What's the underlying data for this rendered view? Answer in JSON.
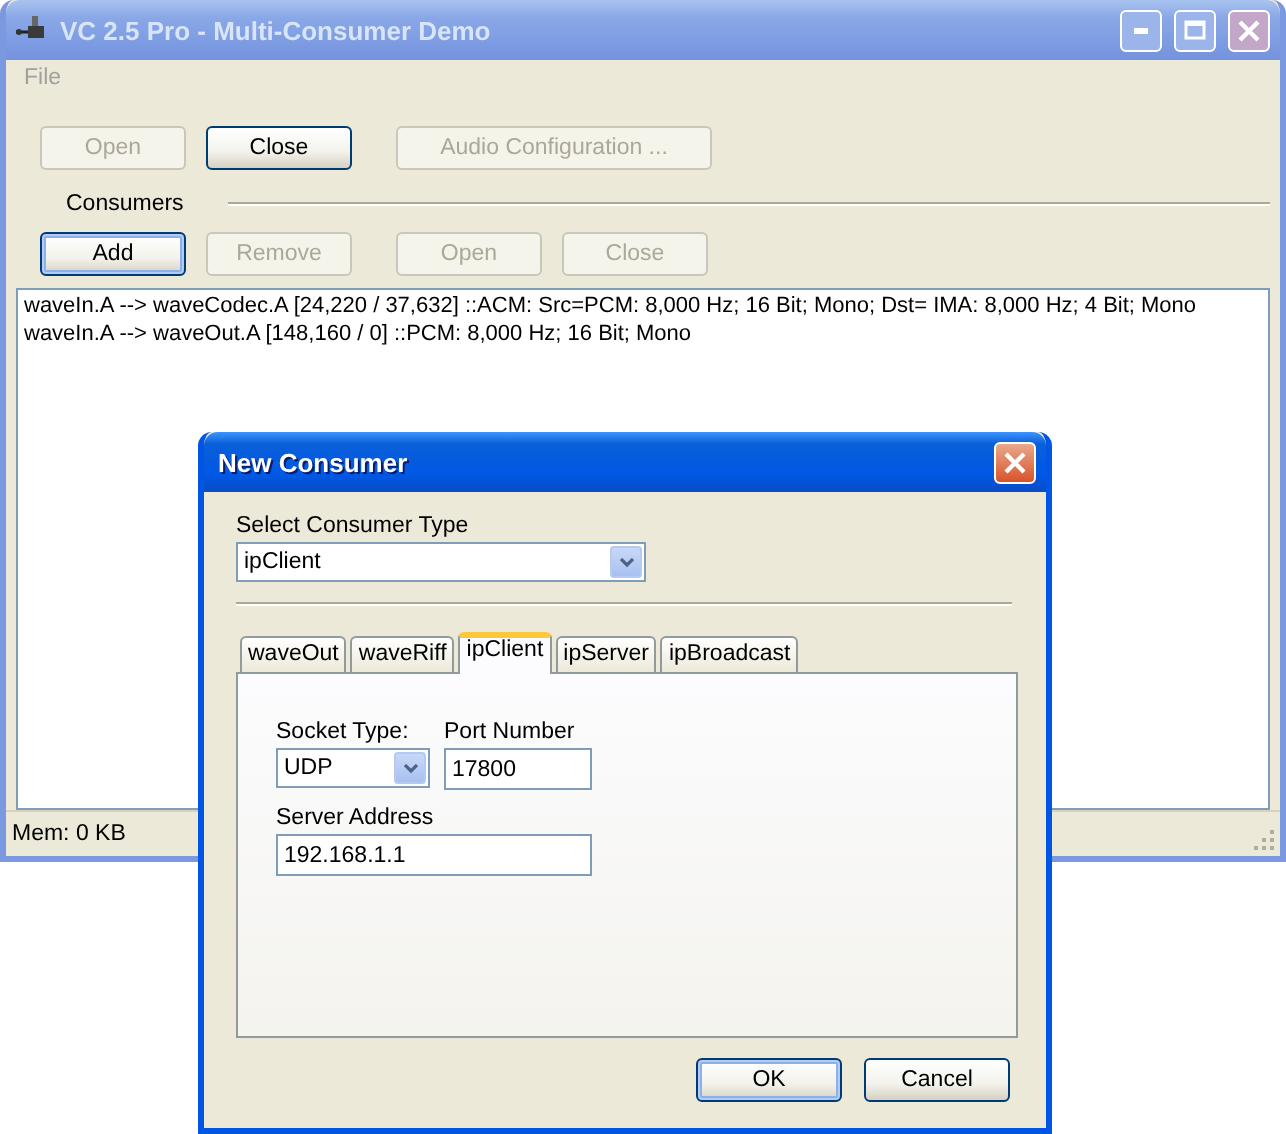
{
  "window": {
    "title": "VC 2.5 Pro - Multi-Consumer Demo",
    "active": false
  },
  "menu": [
    {
      "label": "File"
    }
  ],
  "top_buttons": [
    {
      "label": "Open",
      "disabled": true,
      "default": false
    },
    {
      "label": "Close",
      "disabled": false,
      "default": false
    },
    {
      "label": "Audio Configuration ...",
      "disabled": true,
      "default": false
    }
  ],
  "consumers_label": "Consumers",
  "consumer_buttons": [
    {
      "label": "Add",
      "disabled": false,
      "default": true
    },
    {
      "label": "Remove",
      "disabled": true,
      "default": false
    },
    {
      "label": "Open",
      "disabled": true,
      "default": false
    },
    {
      "label": "Close",
      "disabled": true,
      "default": false
    }
  ],
  "log_lines": [
    "waveIn.A --> waveCodec.A [24,220 / 37,632] ::ACM: Src=PCM: 8,000 Hz; 16 Bit; Mono; Dst= IMA: 8,000 Hz; 4 Bit; Mono",
    "waveIn.A --> waveOut.A [148,160 / 0] ::PCM: 8,000 Hz; 16 Bit; Mono"
  ],
  "status_bar": "Mem: 0 KB",
  "dialog": {
    "title": "New Consumer",
    "active": true,
    "type_label": "Select Consumer Type",
    "type_value": "ipClient",
    "tabs": [
      {
        "label": "waveOut",
        "selected": false
      },
      {
        "label": "waveRiff",
        "selected": false
      },
      {
        "label": "ipClient",
        "selected": true
      },
      {
        "label": "ipServer",
        "selected": false
      },
      {
        "label": "ipBroadcast",
        "selected": false
      }
    ],
    "socket_label": "Socket Type:",
    "socket_value": "UDP",
    "port_label": "Port Number",
    "port_value": "17800",
    "address_label": "Server Address",
    "address_value": "192.168.1.1",
    "buttons": [
      {
        "label": "OK",
        "disabled": false,
        "default": true
      },
      {
        "label": "Cancel",
        "disabled": false,
        "default": false
      }
    ]
  }
}
